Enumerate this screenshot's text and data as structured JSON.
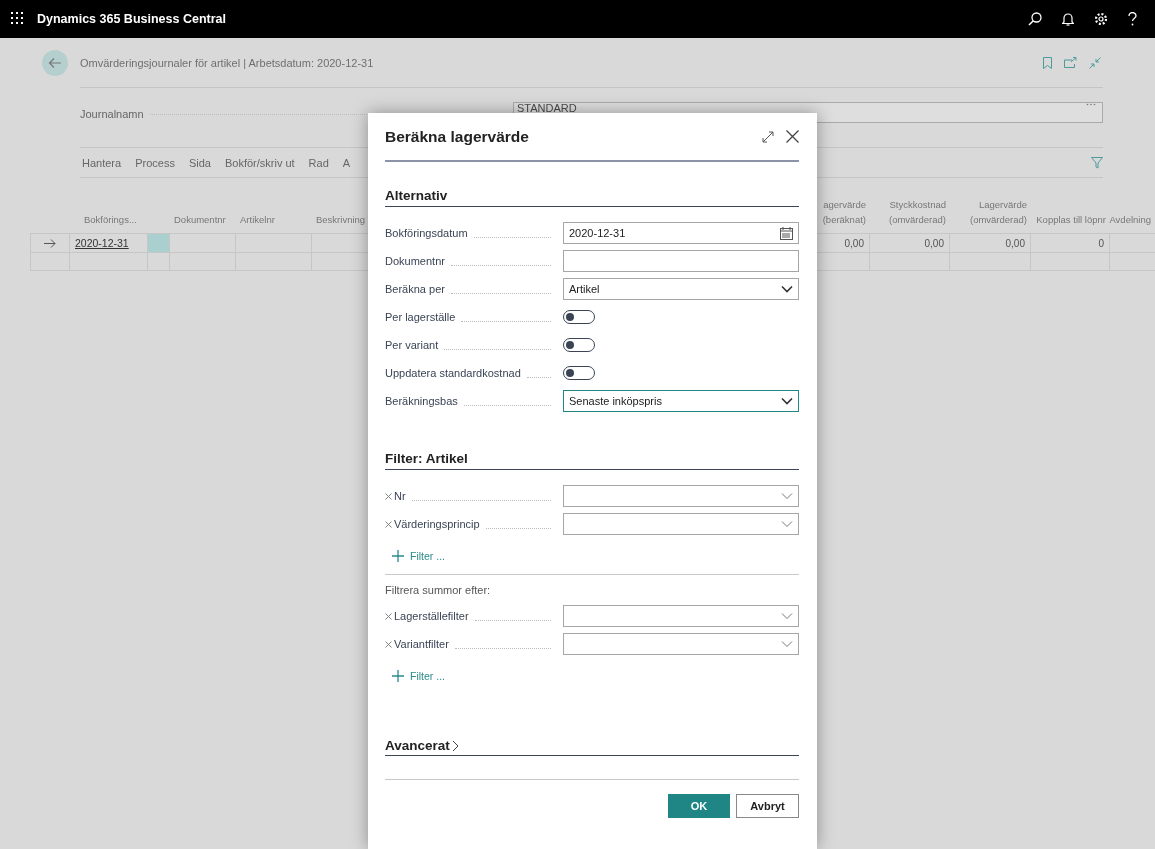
{
  "app_bar": {
    "title": "Dynamics 365 Business Central"
  },
  "page": {
    "title": "Omvärderingsjournaler för artikel | Arbetsdatum: 2020-12-31",
    "journal_name": {
      "label": "Journalnamn",
      "value": "STANDARD"
    },
    "actions": [
      "Hantera",
      "Process",
      "Sida",
      "Bokför/skriv ut",
      "Rad",
      "A"
    ],
    "table": {
      "columns": [
        {
          "label": "Bokförings..."
        },
        {
          "label": "Dokumentnr"
        },
        {
          "label": "Artikelnr"
        },
        {
          "label": "Beskrivning"
        },
        {
          "label": "agervärde (beräknat)"
        },
        {
          "label": "Styckkostnad (omvärderad)"
        },
        {
          "label": "Lagervärde (omvärderad)"
        },
        {
          "label": "Kopplas till löpnr"
        },
        {
          "label": "Avdelning"
        }
      ],
      "rows": [
        {
          "current": true,
          "date": "2020-12-31",
          "values": [
            "0,00",
            "0,00",
            "0,00",
            "0"
          ]
        },
        {
          "current": false
        }
      ]
    }
  },
  "dialog": {
    "title": "Beräkna lagervärde",
    "options": {
      "title": "Alternativ",
      "fields": [
        {
          "kind": "date",
          "label": "Bokföringsdatum",
          "value": "2020-12-31"
        },
        {
          "kind": "text",
          "label": "Dokumentnr"
        },
        {
          "kind": "select",
          "label": "Beräkna per",
          "value": "Artikel",
          "focused": false
        },
        {
          "kind": "toggle",
          "label": "Per lagerställe",
          "on": false
        },
        {
          "kind": "toggle",
          "label": "Per variant",
          "on": false
        },
        {
          "kind": "toggle",
          "label": "Uppdatera standardkostnad",
          "on": false
        },
        {
          "kind": "select",
          "label": "Beräkningsbas",
          "value": "Senaste inköpspris",
          "focused": true
        }
      ]
    },
    "filter": {
      "title": "Filter: Artikel",
      "fields": [
        {
          "label": "Nr"
        },
        {
          "label": "Värderingsprincip"
        }
      ],
      "add_filter": "Filter ...",
      "totals_heading": "Filtrera summor efter:",
      "total_fields": [
        {
          "label": "Lagerställefilter"
        },
        {
          "label": "Variantfilter"
        }
      ],
      "add_total_filter": "Filter ..."
    },
    "advanced": {
      "title": "Avancerat",
      "expanded": false
    },
    "buttons": [
      {
        "label": "OK",
        "kind": "primary"
      },
      {
        "label": "Avbryt",
        "kind": "secondary"
      }
    ]
  }
}
